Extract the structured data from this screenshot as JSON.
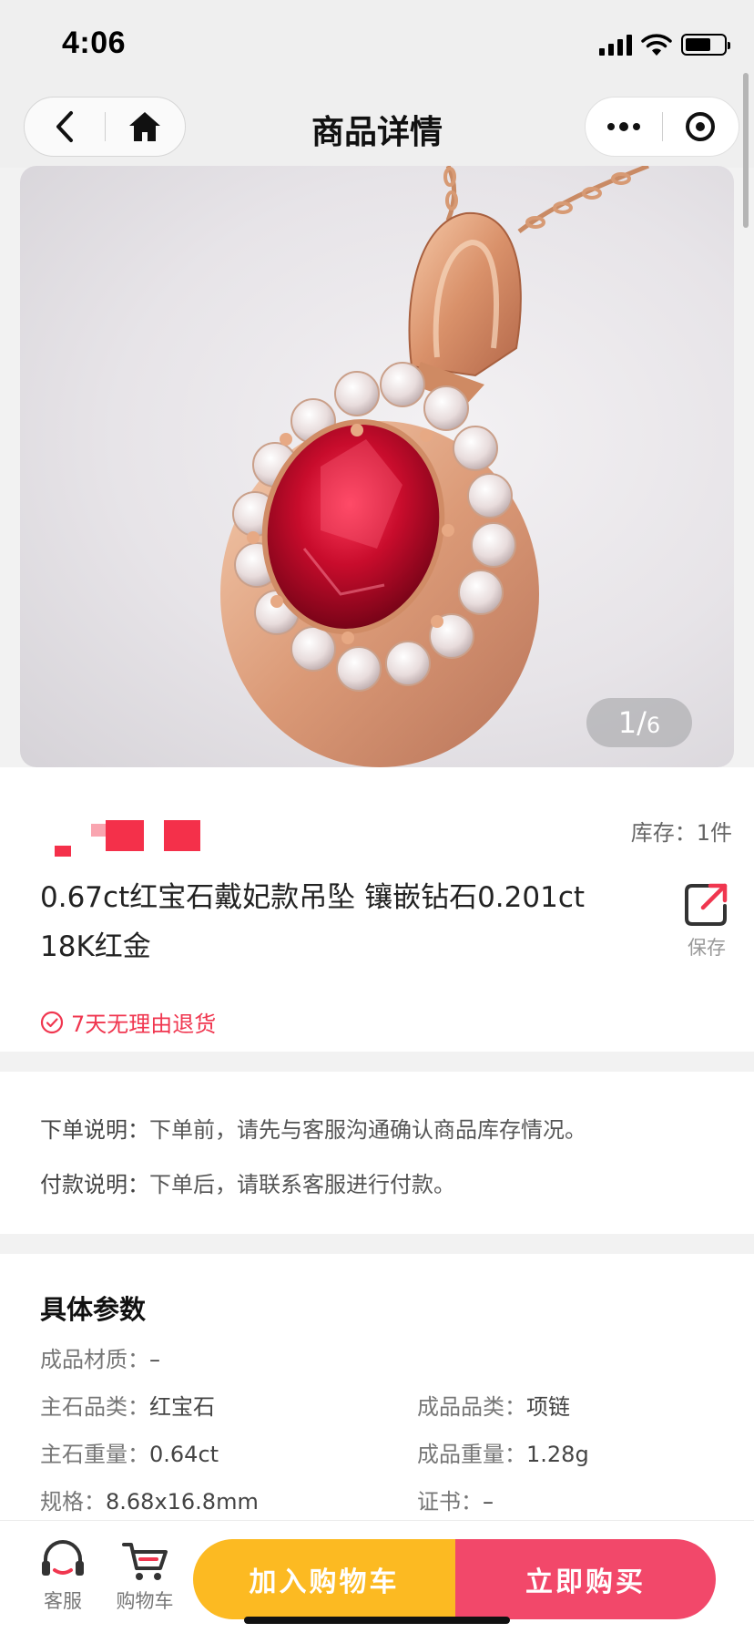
{
  "status_bar": {
    "time": "4:06"
  },
  "nav": {
    "title": "商品详情"
  },
  "gallery": {
    "current": "1",
    "separator": "/",
    "total": "6"
  },
  "product": {
    "stock_label": "库存：",
    "stock_value": "1件",
    "title": "0.67ct红宝石戴妃款吊坠 镶嵌钻石0.201ct 18K红金",
    "save_label": "保存",
    "return_policy": "7天无理由退货",
    "price_color": "#f4304a"
  },
  "notes": {
    "order": {
      "key": "下单说明：",
      "value": "下单前，请先与客服沟通确认商品库存情况。"
    },
    "payment": {
      "key": "付款说明：",
      "value": "下单后，请联系客服进行付款。"
    }
  },
  "params": {
    "title": "具体参数",
    "material": {
      "key": "成品材质：",
      "value": "–"
    },
    "stone_type": {
      "key": "主石品类：",
      "value": "红宝石"
    },
    "product_type": {
      "key": "成品品类：",
      "value": "项链"
    },
    "stone_weight": {
      "key": "主石重量：",
      "value": "0.64ct"
    },
    "product_weight": {
      "key": "成品重量：",
      "value": "1.28g"
    },
    "size": {
      "key": "规格：",
      "value": "8.68x16.8mm"
    },
    "certificate": {
      "key": "证书：",
      "value": "–"
    }
  },
  "bottom_bar": {
    "service_label": "客服",
    "cart_label": "购物车",
    "add_to_cart": "加入购物车",
    "buy_now": "立即购买",
    "cart_color": "#fcba22",
    "buy_color": "#f2486a"
  }
}
